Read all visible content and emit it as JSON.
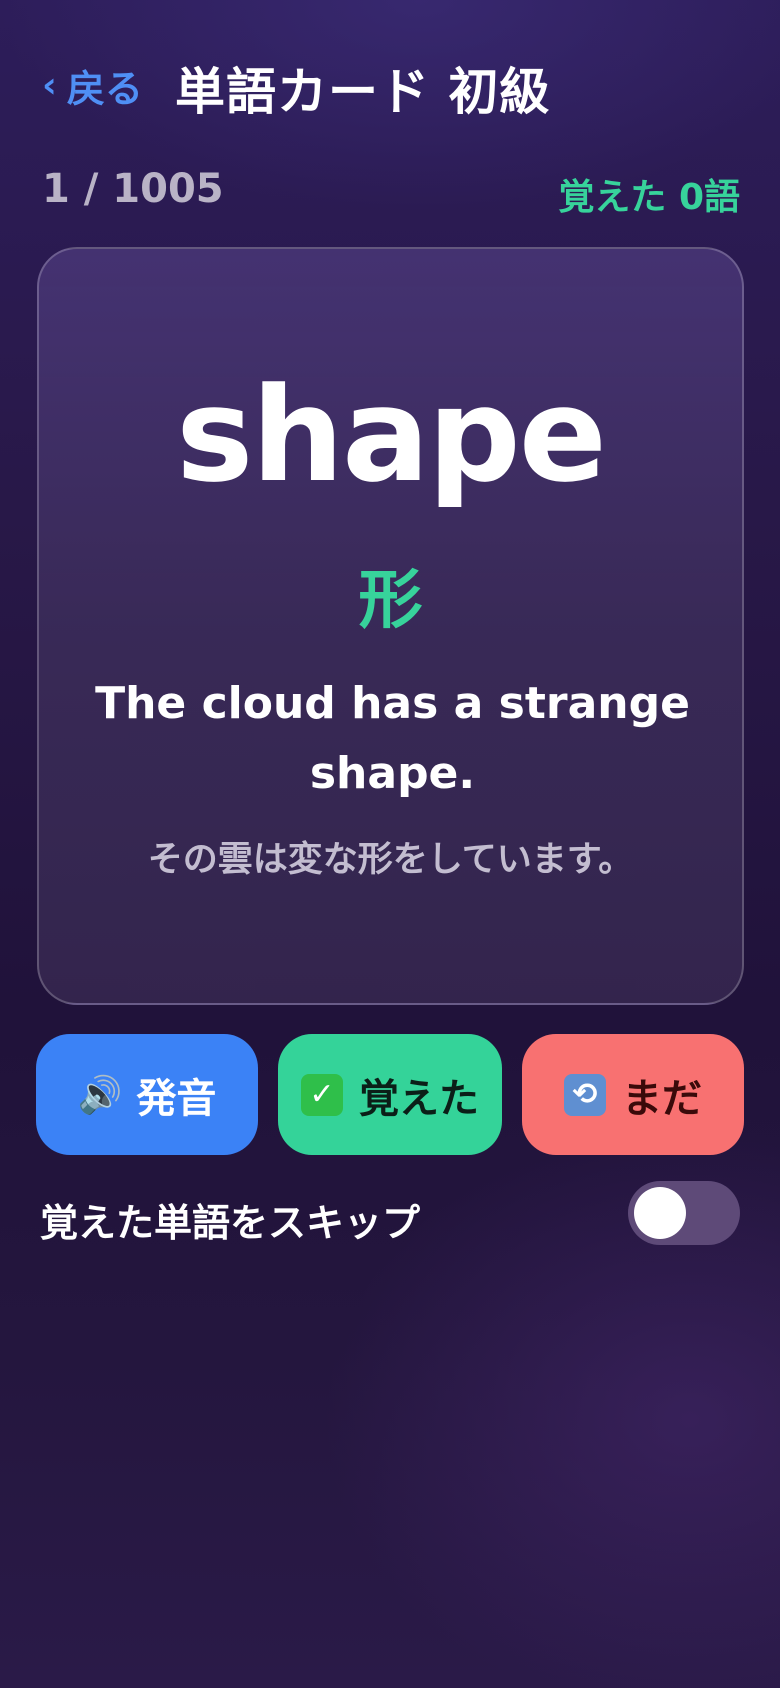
{
  "header": {
    "back_label": "戻る",
    "title": "単語カード 初級"
  },
  "progress": {
    "counter": "1 / 1005",
    "learned": "覚えた 0語"
  },
  "card": {
    "word": "shape",
    "meaning": "形",
    "example": "The cloud has a strange shape.",
    "translation": "その雲は変な形をしています。"
  },
  "buttons": {
    "speak_label": "発音",
    "learned_label": "覚えた",
    "later_label": "まだ",
    "speak_icon": "speaker-icon",
    "learned_icon": "check-icon",
    "later_icon": "repeat-icon"
  },
  "settings": {
    "skip_label": "覚えた単語をスキップ",
    "skip_enabled": false
  },
  "colors": {
    "accent_blue": "#3b82f6",
    "accent_green": "#34d399",
    "accent_red": "#f87171"
  }
}
